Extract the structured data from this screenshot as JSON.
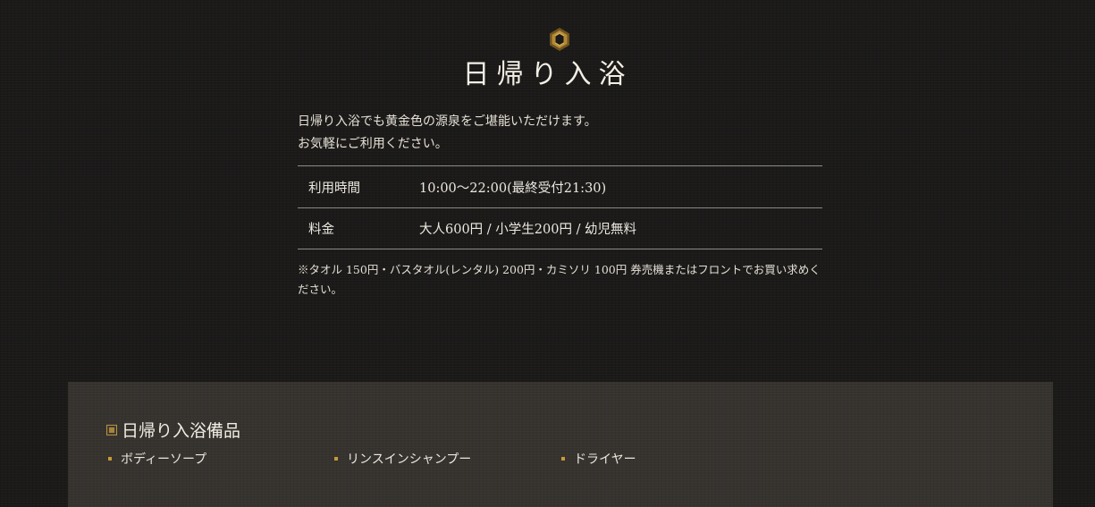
{
  "colors": {
    "background": "#1b1a19",
    "accent_gold": "#c79a35",
    "panel": "#36332f",
    "text": "#e8e4dc"
  },
  "logo": {
    "icon": "gold-hexagon-emblem-icon"
  },
  "section": {
    "title": "日帰り入浴",
    "intro_line1": "日帰り入浴でも黄金色の源泉をご堪能いただけます。",
    "intro_line2": "お気軽にご利用ください。"
  },
  "info": {
    "rows": [
      {
        "label": "利用時間",
        "value": "10:00～22:00(最終受付21:30)"
      },
      {
        "label": "料金",
        "value": "大人600円 / 小学生200円 / 幼児無料"
      }
    ],
    "note": "※タオル 150円・バスタオル(レンタル) 200円・カミソリ 100円 券売機またはフロントでお買い求めください。"
  },
  "amenities": {
    "heading": "日帰り入浴備品",
    "heading_icon": "square-frame-icon",
    "items": [
      "ボディーソープ",
      "リンスインシャンプー",
      "ドライヤー"
    ]
  }
}
